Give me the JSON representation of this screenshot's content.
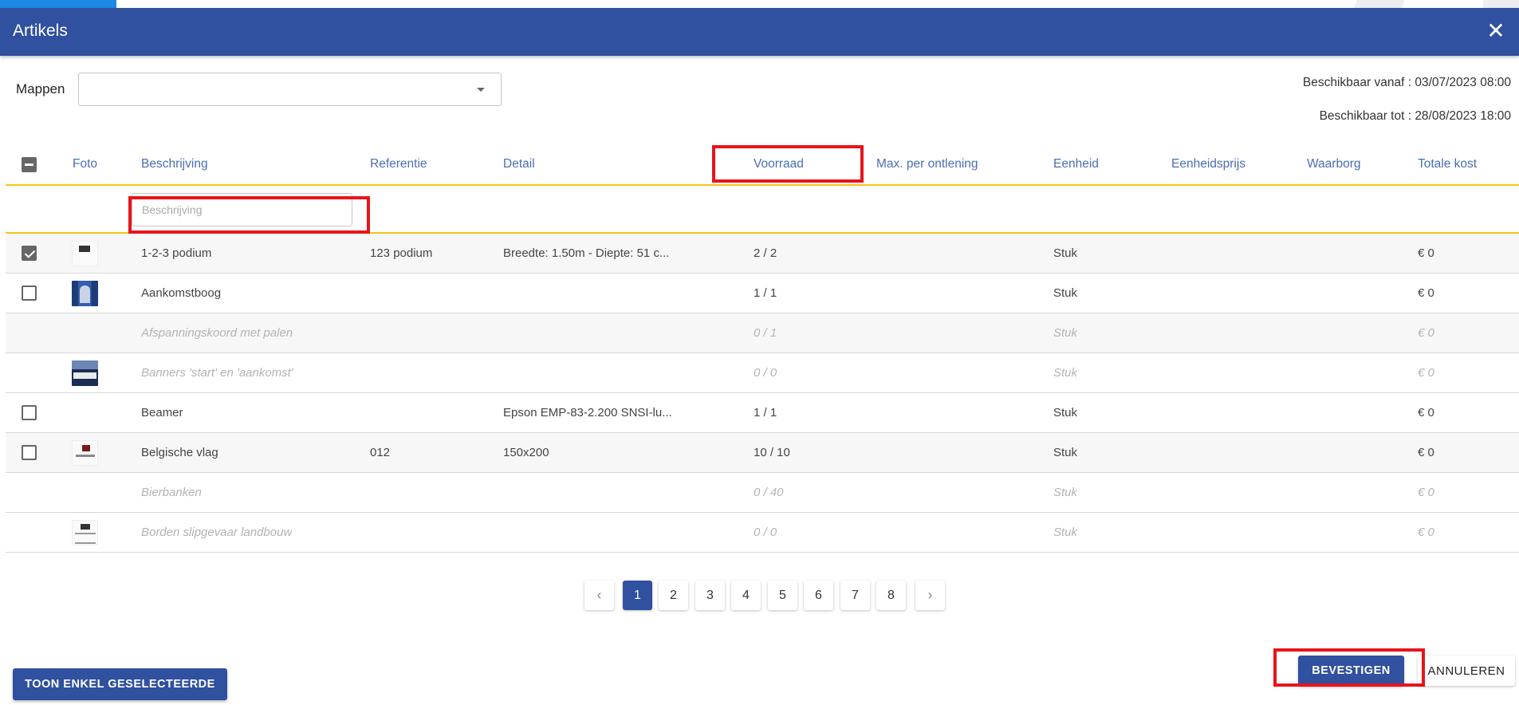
{
  "dialog": {
    "title": "Artikels",
    "close_glyph": "✕"
  },
  "folders": {
    "label": "Mappen",
    "selected": ""
  },
  "availability": {
    "from": "Beschikbaar vanaf : 03/07/2023 08:00",
    "to": "Beschikbaar tot : 28/08/2023 18:00"
  },
  "table": {
    "columns": {
      "photo": "Foto",
      "description": "Beschrijving",
      "reference": "Referentie",
      "detail": "Detail",
      "stock": "Voorraad",
      "max_per_loan": "Max. per ontlening",
      "unit": "Eenheid",
      "unit_price": "Eenheidsprijs",
      "deposit": "Waarborg",
      "total_cost": "Totale kost"
    },
    "filter": {
      "placeholder": "Beschrijving"
    },
    "rows": [
      {
        "description": "1-2-3 podium",
        "reference": "123 podium",
        "detail": "Breedte: 1.50m - Diepte: 51 c...",
        "stock": "2 / 2",
        "unit": "Stuk",
        "total": "€ 0"
      },
      {
        "description": "Aankomstboog",
        "reference": "",
        "detail": "",
        "stock": "1 / 1",
        "unit": "Stuk",
        "total": "€ 0"
      },
      {
        "description": "Afspanningskoord met palen",
        "reference": "",
        "detail": "",
        "stock": "0 / 1",
        "unit": "Stuk",
        "total": "€ 0"
      },
      {
        "description": "Banners 'start' en 'aankomst'",
        "reference": "",
        "detail": "",
        "stock": "0 / 0",
        "unit": "Stuk",
        "total": "€ 0"
      },
      {
        "description": "Beamer",
        "reference": "",
        "detail": "Epson EMP-83-2.200 SNSI-lu...",
        "stock": "1 / 1",
        "unit": "Stuk",
        "total": "€ 0"
      },
      {
        "description": "Belgische vlag",
        "reference": "012",
        "detail": "150x200",
        "stock": "10 / 10",
        "unit": "Stuk",
        "total": "€ 0"
      },
      {
        "description": "Bierbanken",
        "reference": "",
        "detail": "",
        "stock": "0 / 40",
        "unit": "Stuk",
        "total": "€ 0"
      },
      {
        "description": "Borden slipgevaar landbouw",
        "reference": "",
        "detail": "",
        "stock": "0 / 0",
        "unit": "Stuk",
        "total": "€ 0"
      }
    ]
  },
  "pagination": {
    "prev": "‹",
    "next": "›",
    "pages": [
      "1",
      "2",
      "3",
      "4",
      "5",
      "6",
      "7",
      "8"
    ],
    "current": "1"
  },
  "footer": {
    "show_selected": "TOON ENKEL GESELECTEERDE",
    "confirm": "BEVESTIGEN",
    "cancel": "ANNULEREN"
  },
  "icons": {
    "close": "close-icon",
    "dropdown": "caret-down-icon",
    "checkbox_checked": "checkbox-checked-icon",
    "checkbox_empty": "checkbox-empty-icon",
    "checkbox_indeterminate": "checkbox-indeterminate-icon"
  },
  "colors": {
    "header": "#3050a0",
    "accent_yellow": "#f5c518",
    "column_header_text": "#4a6eb5",
    "highlight": "#e8141b"
  }
}
